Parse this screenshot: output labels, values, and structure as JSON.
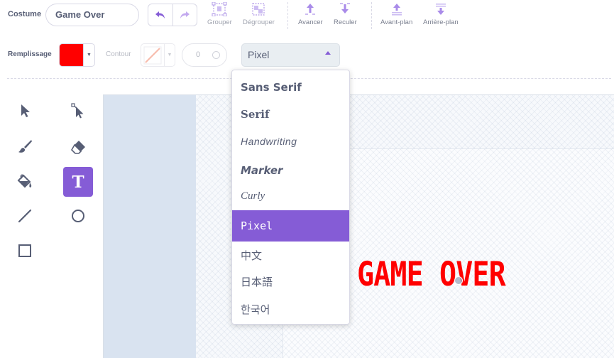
{
  "toolbar": {
    "costume_label": "Costume",
    "costume_name": "Game Over",
    "group_label": "Grouper",
    "ungroup_label": "Dégrouper",
    "forward_label": "Avancer",
    "backward_label": "Reculer",
    "front_label": "Avant-plan",
    "back_label": "Arrière-plan"
  },
  "style": {
    "fill_label": "Remplissage",
    "fill_color": "#ff0000",
    "outline_label": "Contour",
    "outline_width": "0",
    "font_selected": "Pixel",
    "accent_color": "#855cd6"
  },
  "tools": [
    {
      "name": "select",
      "icon": "arrow-icon"
    },
    {
      "name": "reshape",
      "icon": "reshape-icon"
    },
    {
      "name": "brush",
      "icon": "brush-icon"
    },
    {
      "name": "eraser",
      "icon": "eraser-icon"
    },
    {
      "name": "fill",
      "icon": "fill-bucket-icon"
    },
    {
      "name": "text",
      "icon": "text-icon",
      "letter": "T",
      "selected": true
    },
    {
      "name": "line",
      "icon": "line-icon"
    },
    {
      "name": "circle",
      "icon": "circle-icon"
    },
    {
      "name": "rectangle",
      "icon": "rectangle-icon"
    }
  ],
  "font_menu": {
    "items": [
      "Sans Serif",
      "Serif",
      "Handwriting",
      "Marker",
      "Curly",
      "Pixel",
      "中文",
      "日本語",
      "한국어"
    ],
    "selected_index": 5
  },
  "canvas": {
    "text": "GAME OVER",
    "text_color": "#ff0000"
  }
}
